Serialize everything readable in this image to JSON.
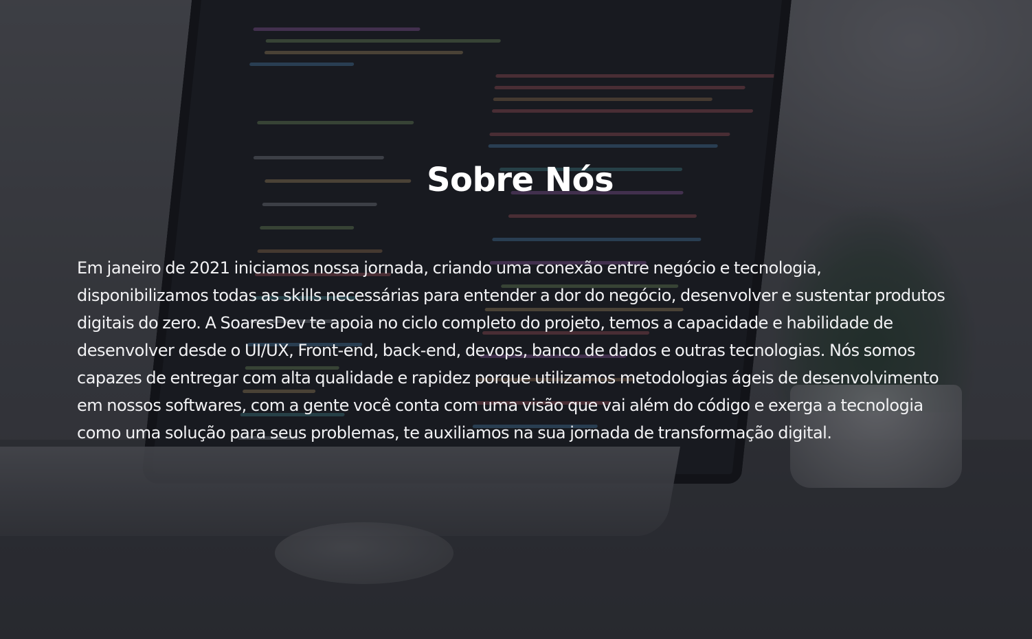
{
  "section": {
    "title": "Sobre Nós",
    "paragraph": "Em janeiro de 2021 iniciamos nossa jornada, criando uma conexão entre negócio e tecnologia, disponibilizamos todas as skills necessárias para entender a dor do negócio, desenvolver e sustentar produtos digitais do zero. A SoaresDev te apoia no ciclo completo do projeto, temos a capacidade e habilidade de desenvolver desde o UI/UX, Front-end, back-end, devops, banco de dados e outras tecnologias. Nós somos capazes de entregar com alta qualidade e rapidez porque utilizamos metodologias ágeis de desenvolvimento em nossos softwares, com a gente você conta com uma visão que vai além do código e exerga a tecnologia como uma solução para seus problemas, te auxiliamos na sua jornada de transformação digital."
  },
  "colors": {
    "overlay": "#16181e",
    "title_text": "#ffffff",
    "body_text": "#f2f2f4"
  }
}
